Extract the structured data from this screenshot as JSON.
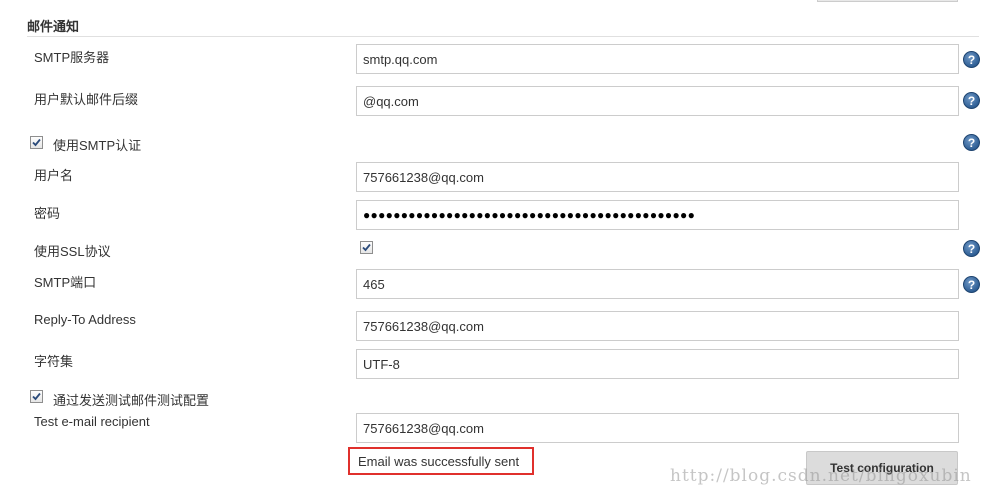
{
  "section": {
    "title": "邮件通知"
  },
  "smtp_server": {
    "label": "SMTP服务器",
    "value": "smtp.qq.com"
  },
  "default_suffix": {
    "label": "用户默认邮件后缀",
    "value": "@qq.com"
  },
  "smtp_auth": {
    "label": "使用SMTP认证",
    "checked": true
  },
  "username": {
    "label": "用户名",
    "value": "757661238@qq.com"
  },
  "password": {
    "label": "密码",
    "value": "●●●●●●●●●●●●●●●●●●●●●●●●●●●●●●●●●●●●●●●●●●●●"
  },
  "use_ssl": {
    "label": "使用SSL协议",
    "checked": true
  },
  "smtp_port": {
    "label": "SMTP端口",
    "value": "465"
  },
  "reply_to": {
    "label": "Reply-To Address",
    "value": "757661238@qq.com"
  },
  "charset": {
    "label": "字符集",
    "value": "UTF-8"
  },
  "test_config": {
    "label": "通过发送测试邮件测试配置",
    "checked": true
  },
  "test_recipient": {
    "label": "Test e-mail recipient",
    "value": "757661238@qq.com"
  },
  "status": {
    "message": "Email was successfully sent"
  },
  "button": {
    "label": "Test configuration"
  },
  "help": {
    "glyph": "?"
  },
  "watermark": {
    "text": "http://blog.csdn.net/bingoxubin"
  },
  "colors": {
    "help_icon": "#2f5f95",
    "status_border": "#e0302c",
    "button_bg": "#dcdcdc"
  }
}
